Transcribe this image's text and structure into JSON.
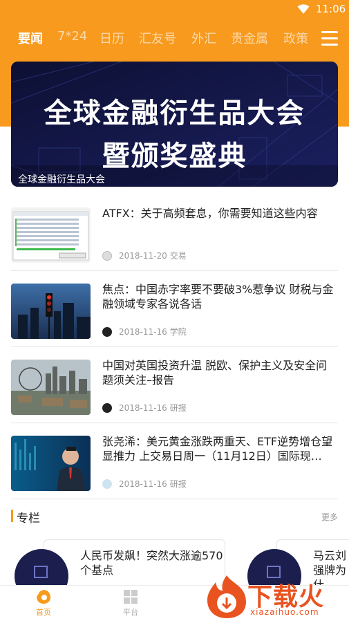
{
  "status": {
    "time": "11:06",
    "icon": "wifi-icon"
  },
  "tabs": [
    "要闻",
    "7*24",
    "日历",
    "汇友号",
    "外汇",
    "贵金属",
    "政策"
  ],
  "banner": {
    "line1": "全球金融衍生品大会",
    "line2": "暨颁奖盛典",
    "caption": "全球金融衍生品大会"
  },
  "news": [
    {
      "title": "ATFX：关于高频套息，你需要知道这些内容",
      "date": "2018-11-20",
      "category": "交易"
    },
    {
      "title": "焦点：中国赤字率要不要破3%惹争议 财税与金融领域专家各说各话",
      "date": "2018-11-16",
      "category": "学院"
    },
    {
      "title": "中国对英国投资升温 脱欧、保护主义及安全问题须关注–报告",
      "date": "2018-11-16",
      "category": "研报"
    },
    {
      "title": "张尧浠：美元黄金涨跌两重天、ETF逆势增仓望显推力 上交易日周一（11月12日）国际现…",
      "date": "2018-11-16",
      "category": "研报"
    }
  ],
  "section": {
    "title": "专栏",
    "more": "更多"
  },
  "cards": [
    {
      "title": "人民币发飙！突然大涨逾570个基点"
    },
    {
      "title": "马云刘强牌为什"
    }
  ],
  "bottom_nav": [
    {
      "label": "首页"
    },
    {
      "label": "平台"
    }
  ],
  "watermark": {
    "text": "下载火",
    "url": "xiazaihuo.com"
  },
  "colors": {
    "accent": "#f79a1e",
    "watermark": "#e8531f"
  }
}
